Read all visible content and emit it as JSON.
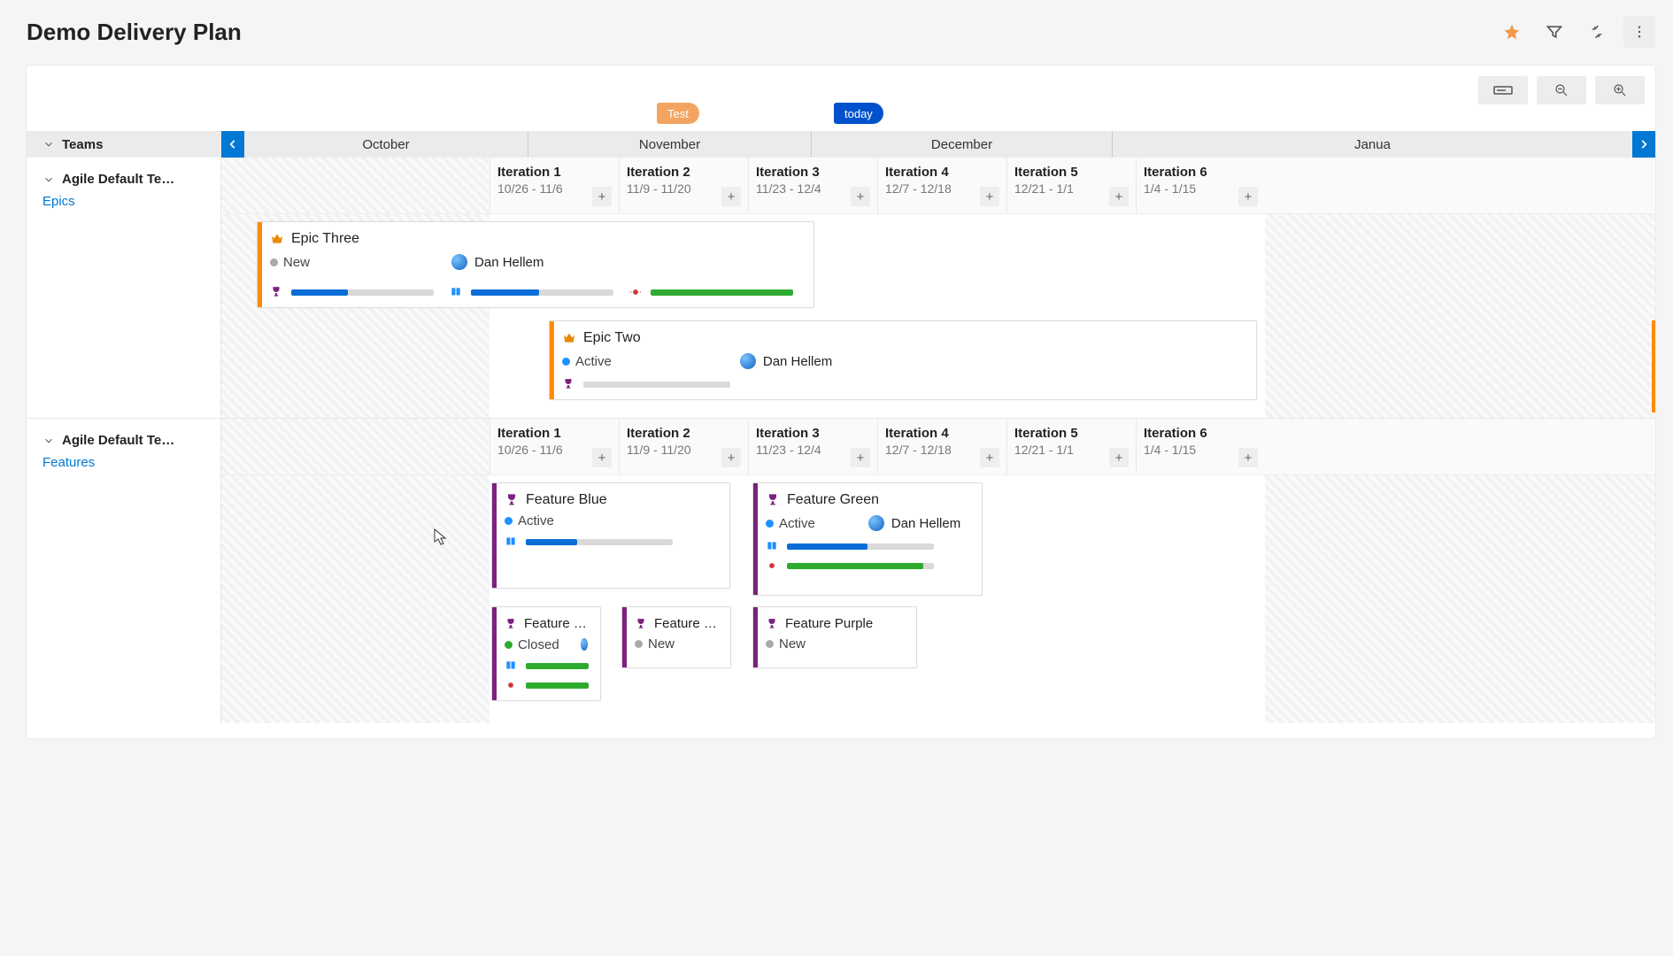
{
  "header": {
    "title": "Demo Delivery Plan",
    "teams_label": "Teams"
  },
  "markers": {
    "test": "Test",
    "today": "today"
  },
  "months": {
    "oct": "October",
    "nov": "November",
    "dec": "December",
    "jan": "Janua"
  },
  "iterations": [
    {
      "title": "Iteration 1",
      "dates": "10/26 - 11/6"
    },
    {
      "title": "Iteration 2",
      "dates": "11/9 - 11/20"
    },
    {
      "title": "Iteration 3",
      "dates": "11/23 - 12/4"
    },
    {
      "title": "Iteration 4",
      "dates": "12/7 - 12/18"
    },
    {
      "title": "Iteration 5",
      "dates": "12/21 - 1/1"
    },
    {
      "title": "Iteration 6",
      "dates": "1/4 - 1/15"
    }
  ],
  "teams": [
    {
      "name": "Agile Default Te…",
      "backlog": "Epics"
    },
    {
      "name": "Agile Default Te…",
      "backlog": "Features"
    }
  ],
  "epics": {
    "three": {
      "title": "Epic Three",
      "state": "New",
      "assignee": "Dan Hellem",
      "rollups": [
        {
          "icon": "trophy",
          "color": "blue",
          "pct": 40
        },
        {
          "icon": "book",
          "color": "blue",
          "pct": 48
        },
        {
          "icon": "bug",
          "color": "green",
          "pct": 100
        }
      ]
    },
    "two": {
      "title": "Epic Two",
      "state": "Active",
      "assignee": "Dan Hellem",
      "rollups": [
        {
          "icon": "trophy",
          "color": "grey",
          "pct": 0
        }
      ]
    }
  },
  "features": {
    "blue": {
      "title": "Feature Blue",
      "state": "Active",
      "assignee": "",
      "rollups": [
        {
          "icon": "book",
          "color": "blue",
          "pct": 35
        }
      ]
    },
    "green": {
      "title": "Feature Green",
      "state": "Active",
      "assignee": "Dan Hellem",
      "rollups": [
        {
          "icon": "book",
          "color": "blue",
          "pct": 55
        },
        {
          "icon": "bug",
          "color": "green",
          "pct": 93
        }
      ]
    },
    "trunc1": {
      "title": "Feature …",
      "state": "Closed",
      "assignee": "",
      "rollups": [
        {
          "icon": "book",
          "color": "green",
          "pct": 100
        }
      ]
    },
    "trunc2": {
      "title": "Feature …",
      "state": "New",
      "assignee": "",
      "rollups": []
    },
    "purple": {
      "title": "Feature Purple",
      "state": "New",
      "assignee": "",
      "rollups": []
    }
  },
  "colors": {
    "orange": "#ff8c00",
    "purple": "#7b217f",
    "blue": "#0a6cd6",
    "green": "#2eab2e"
  }
}
